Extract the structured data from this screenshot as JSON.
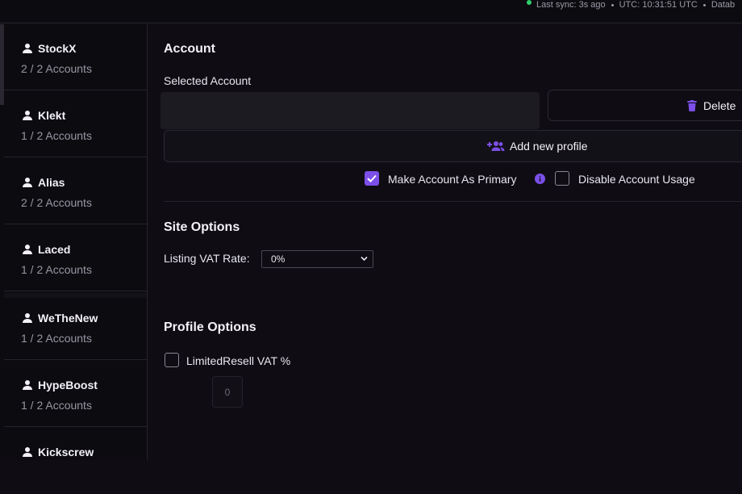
{
  "status": {
    "last_sync": "Last sync: 3s ago",
    "utc": "UTC: 10:31:51 UTC",
    "database": "Datab"
  },
  "sidebar": {
    "items": [
      {
        "name": "StockX",
        "count": "2 / 2 Accounts"
      },
      {
        "name": "Klekt",
        "count": "1 / 2 Accounts"
      },
      {
        "name": "Alias",
        "count": "2 / 2 Accounts"
      },
      {
        "name": "Laced",
        "count": "1 / 2 Accounts"
      },
      {
        "name": "WeTheNew",
        "count": "1 / 2 Accounts"
      },
      {
        "name": "HypeBoost",
        "count": "1 / 2 Accounts"
      },
      {
        "name": "Kickscrew",
        "count": ""
      }
    ]
  },
  "account": {
    "heading": "Account",
    "selected_label": "Selected Account",
    "delete_label": "Delete",
    "add_profile_label": "Add new profile",
    "primary_label": "Make Account As Primary",
    "primary_checked": true,
    "disable_label": "Disable Account Usage",
    "disable_checked": false
  },
  "site_options": {
    "heading": "Site Options",
    "vat_label": "Listing VAT Rate:",
    "vat_value": "0%"
  },
  "profile_options": {
    "heading": "Profile Options",
    "limitedresell_label": "LimitedResell VAT %",
    "limitedresell_checked": false,
    "vat_input_value": "0"
  },
  "colors": {
    "accent": "#7b4fe8",
    "status_ok": "#2fd06a",
    "background": "#0f0d13"
  }
}
